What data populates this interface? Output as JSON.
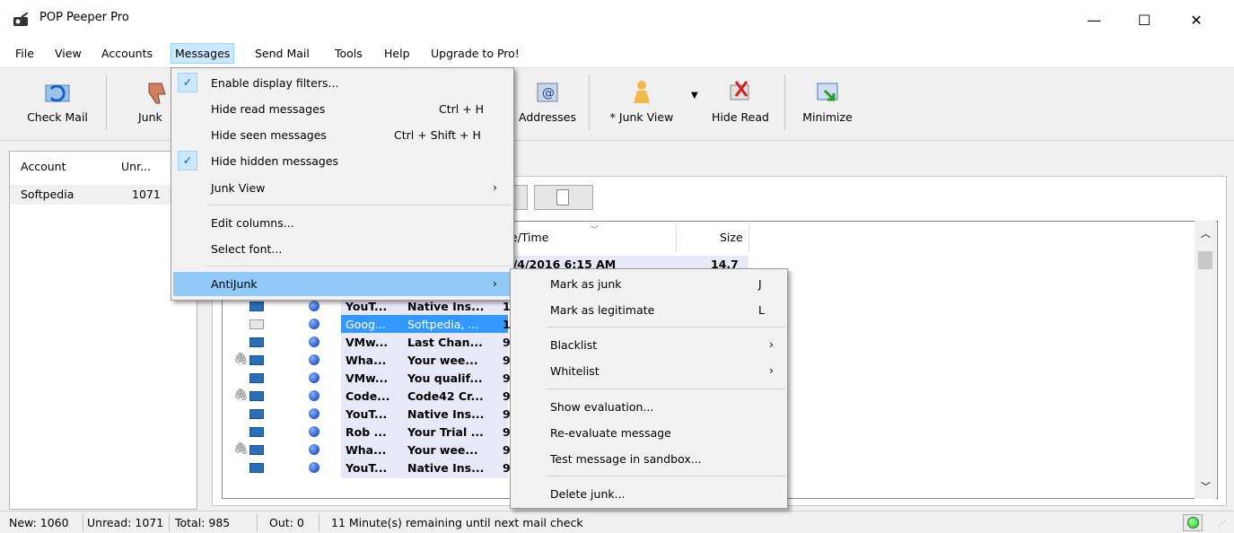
{
  "window": {
    "title": "POP Peeper Pro",
    "minimize_glyph": "—",
    "maximize_glyph": "☐",
    "close_glyph": "✕"
  },
  "menubar": [
    "File",
    "View",
    "Accounts",
    "Messages",
    "Send Mail",
    "Tools",
    "Help",
    "Upgrade to Pro!"
  ],
  "toolbar": {
    "check_mail": "Check Mail",
    "junk": "Junk",
    "addresses": "Addresses",
    "junk_view": "* Junk View",
    "hide_read": "Hide Read",
    "minimize": "Minimize"
  },
  "accounts": {
    "col_account": "Account",
    "col_unread": "Unr...",
    "rows": [
      {
        "name": "Softpedia",
        "unread": "1071"
      }
    ]
  },
  "messages_header": {
    "datetime": "te/Time",
    "size": "Size"
  },
  "first_message": {
    "datetime": ")/4/2016 6:15 AM",
    "size": "14.7 K"
  },
  "messages": [
    {
      "from": "YouT...",
      "subject": "Native Ins...",
      "date": "1",
      "attach": false,
      "open": false,
      "selected": false
    },
    {
      "from": "Goog...",
      "subject": "Softpedia, ...",
      "date": "1",
      "attach": false,
      "open": true,
      "selected": true
    },
    {
      "from": "VMw...",
      "subject": "Last Chan...",
      "date": "9",
      "attach": false,
      "open": false,
      "selected": false
    },
    {
      "from": "Wha...",
      "subject": "Your wee...",
      "date": "9",
      "attach": true,
      "open": false,
      "selected": false
    },
    {
      "from": "VMw...",
      "subject": "You qualif...",
      "date": "9",
      "attach": false,
      "open": false,
      "selected": false
    },
    {
      "from": "Code...",
      "subject": "Code42 Cr...",
      "date": "9",
      "attach": true,
      "open": false,
      "selected": false
    },
    {
      "from": "YouT...",
      "subject": "Native Ins...",
      "date": "9",
      "attach": false,
      "open": false,
      "selected": false
    },
    {
      "from": "Rob ...",
      "subject": "Your Trial ...",
      "date": "9",
      "attach": false,
      "open": false,
      "selected": false
    },
    {
      "from": "Wha...",
      "subject": "Your wee...",
      "date": "9",
      "attach": true,
      "open": false,
      "selected": false
    },
    {
      "from": "YouT...",
      "subject": "Native Ins...",
      "date": "9",
      "attach": false,
      "open": false,
      "selected": false
    }
  ],
  "messages_menu": {
    "enable_filters": "Enable display filters...",
    "hide_read": "Hide read messages",
    "hide_read_sc": "Ctrl + H",
    "hide_seen": "Hide seen messages",
    "hide_seen_sc": "Ctrl + Shift + H",
    "hide_hidden": "Hide hidden messages",
    "junk_view": "Junk View",
    "edit_columns": "Edit columns...",
    "select_font": "Select font...",
    "antijunk": "AntiJunk"
  },
  "antijunk_menu": {
    "mark_junk": "Mark as junk",
    "mark_junk_sc": "J",
    "mark_legit": "Mark as legitimate",
    "mark_legit_sc": "L",
    "blacklist": "Blacklist",
    "whitelist": "Whitelist",
    "show_eval": "Show evaluation...",
    "reeval": "Re-evaluate message",
    "sandbox": "Test message in sandbox...",
    "delete_junk": "Delete junk..."
  },
  "status": {
    "new": "New: 1060",
    "unread": "Unread: 1071",
    "total": "Total: 985",
    "out": "Out: 0",
    "next_check": "11 Minute(s) remaining until next mail check"
  },
  "glyphs": {
    "check": "✓",
    "arrow": "›",
    "attach": "🖇"
  },
  "colors": {
    "accent": "#cce8ff",
    "hover": "#91c9f7",
    "selection": "#3399ff",
    "status_led": "#2bbf2b"
  }
}
